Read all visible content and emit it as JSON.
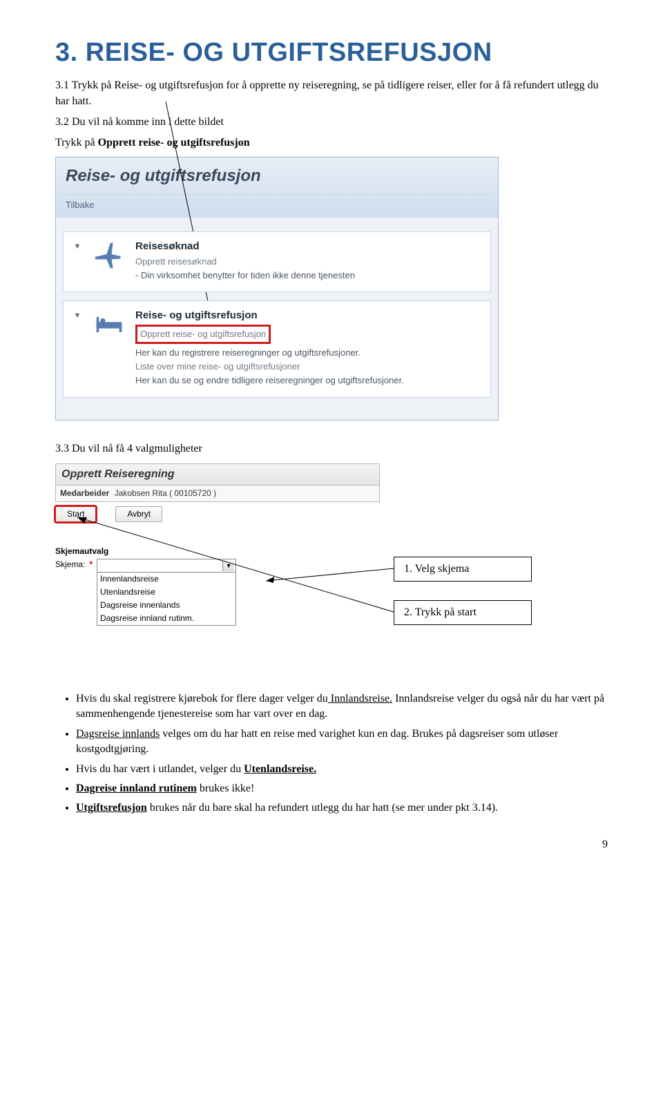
{
  "heading": "3. REISE- OG UTGIFTSREFUSJON",
  "intro": "3.1 Trykk på Reise- og utgiftsrefusjon for å opprette ny reiseregning, se på tidligere reiser, eller for å få refundert utlegg du har hatt.",
  "p32a": "3.2 Du vil nå komme inn i dette bildet",
  "p32b_pre": "Trykk på ",
  "p32b_bold": "Opprett reise- og utgiftsrefusjon",
  "shot1": {
    "title": "Reise- og utgiftsrefusjon",
    "back": "Tilbake",
    "block1": {
      "title": "Reisesøknad",
      "link": "Opprett reisesøknad",
      "desc": "- Din virksomhet benytter for tiden ikke denne tjenesten"
    },
    "block2": {
      "title": "Reise- og utgiftsrefusjon",
      "link1": "Opprett reise- og utgiftsrefusjon",
      "desc1": "Her kan du registrere reiseregninger og utgiftsrefusjoner.",
      "link2": "Liste over mine reise- og utgiftsrefusjoner",
      "desc2": "Her kan du se og endre tidligere reiseregninger og utgiftsrefusjoner."
    }
  },
  "p33": "3.3 Du vil nå få 4 valgmuligheter",
  "shot2": {
    "title": "Opprett Reiseregning",
    "meda_label": "Medarbeider",
    "meda_value": "Jakobsen Rita ( 00105720 )",
    "start": "Start",
    "avbryt": "Avbryt",
    "skjemautvalg": "Skjemautvalg",
    "skjema_label": "Skjema:",
    "selected": "",
    "options": [
      "Innenlandsreise",
      "Utenlandsreise",
      "Dagsreise innenlands",
      "Dagsreise innland rutinm."
    ]
  },
  "step1": "1. Velg skjema",
  "step2": "2. Trykk på start",
  "bullets": {
    "b1a": "Hvis du skal registrere kjørebok for flere dager velger du",
    "b1u": " Innlandsreise.",
    "b1b": " Innlandsreise velger du også når du har vært på sammenhengende tjenestereise som har vart over en dag.",
    "b2u": "Dagsreise innlands",
    "b2b": " velges om du har hatt en reise med varighet kun en dag. Brukes på dagsreiser som utløser kostgodtgjøring.",
    "b3a": "Hvis du har vært i utlandet, velger du ",
    "b3u": "Utenlandsreise.",
    "b4u": "Dagreise innland rutinem",
    "b4b": " brukes ikke!",
    "b5u": "Utgiftsrefusjon",
    "b5b": " brukes når du bare skal ha refundert utlegg du har hatt (se mer under pkt 3.14)."
  },
  "pagenum": "9"
}
